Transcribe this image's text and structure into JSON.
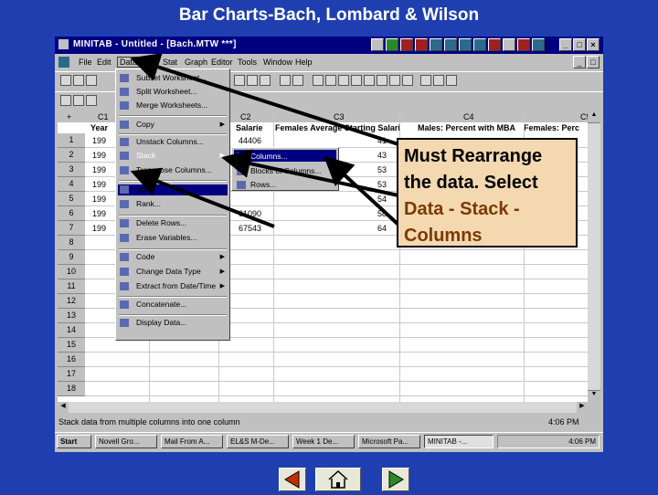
{
  "slide": {
    "title": "Bar Charts-Bach, Lombard & Wilson"
  },
  "window": {
    "title": "MINITAB - Untitled - [Bach.MTW ***]",
    "menu": [
      "File",
      "Edit",
      "Data",
      "Calc",
      "Stat",
      "Graph",
      "Editor",
      "Tools",
      "Window",
      "Help"
    ]
  },
  "worksheet": {
    "column_headers": [
      "+",
      "C1",
      "C2",
      "C3",
      "C4",
      "C5"
    ],
    "column_names": [
      "Year",
      "Salarie",
      "Females Average Starting Salari",
      "Males: Percent with MBA",
      "Females: Perc"
    ],
    "rows": [
      {
        "n": "1",
        "year": "199",
        "salary": "44406",
        "c3": "41"
      },
      {
        "n": "2",
        "year": "199",
        "salary": "",
        "c3": "43"
      },
      {
        "n": "3",
        "year": "199",
        "salary": "",
        "c3": "53"
      },
      {
        "n": "4",
        "year": "199",
        "salary": "",
        "c3": "53"
      },
      {
        "n": "5",
        "year": "199",
        "salary": "",
        "c3": "54"
      },
      {
        "n": "6",
        "year": "199",
        "salary": "61090",
        "c3": "58"
      },
      {
        "n": "7",
        "year": "199",
        "salary": "67543",
        "c3": "64"
      },
      {
        "n": "8",
        "year": "",
        "salary": "",
        "c3": ""
      },
      {
        "n": "9",
        "year": "",
        "salary": "",
        "c3": ""
      },
      {
        "n": "10",
        "year": "",
        "salary": "",
        "c3": ""
      },
      {
        "n": "11",
        "year": "",
        "salary": "",
        "c3": ""
      },
      {
        "n": "12",
        "year": "",
        "salary": "",
        "c3": ""
      },
      {
        "n": "13",
        "year": "",
        "salary": "",
        "c3": ""
      },
      {
        "n": "14",
        "year": "",
        "salary": "",
        "c3": ""
      },
      {
        "n": "15",
        "year": "",
        "salary": "",
        "c3": ""
      },
      {
        "n": "16",
        "year": "",
        "salary": "",
        "c3": ""
      },
      {
        "n": "17",
        "year": "",
        "salary": "",
        "c3": ""
      },
      {
        "n": "18",
        "year": "",
        "salary": "",
        "c3": ""
      }
    ]
  },
  "data_menu": {
    "items": [
      "Subset Worksheet...",
      "Split Worksheet...",
      "Merge Worksheets...",
      "Copy",
      "Unstack Columns...",
      "Stack",
      "Transpose Columns...",
      "Sort...",
      "Rank...",
      "Delete Rows...",
      "Erase Variables...",
      "Code",
      "Change Data Type",
      "Extract from Date/Time",
      "Concatenate...",
      "Display Data..."
    ]
  },
  "stack_submenu": {
    "items": [
      "Columns...",
      "Blocks of Columns...",
      "Rows..."
    ]
  },
  "status": {
    "text": "Stack data from multiple columns into one column",
    "clock": "4:06 PM"
  },
  "taskbar": {
    "start": "Start",
    "tasks": [
      "Novell Gro...",
      "Mail From A...",
      "EL&S M-De...",
      "Week 1 De...",
      "Microsoft Pa...",
      "MINITAB -..."
    ],
    "clock": "4:06 PM"
  },
  "callout": {
    "line1": "Must Rearrange",
    "line2": "the data.  Select",
    "line3": "Data - Stack -",
    "line4": "Columns"
  },
  "colors": {
    "background": "#1f3fb0",
    "titlebar": "#000080",
    "callout_fill": "#f4d8b0",
    "callout_text_black": "#000000",
    "callout_text_brown": "#7a3a00"
  },
  "nav": [
    "previous-arrow-icon",
    "home-icon",
    "next-arrow-icon"
  ]
}
